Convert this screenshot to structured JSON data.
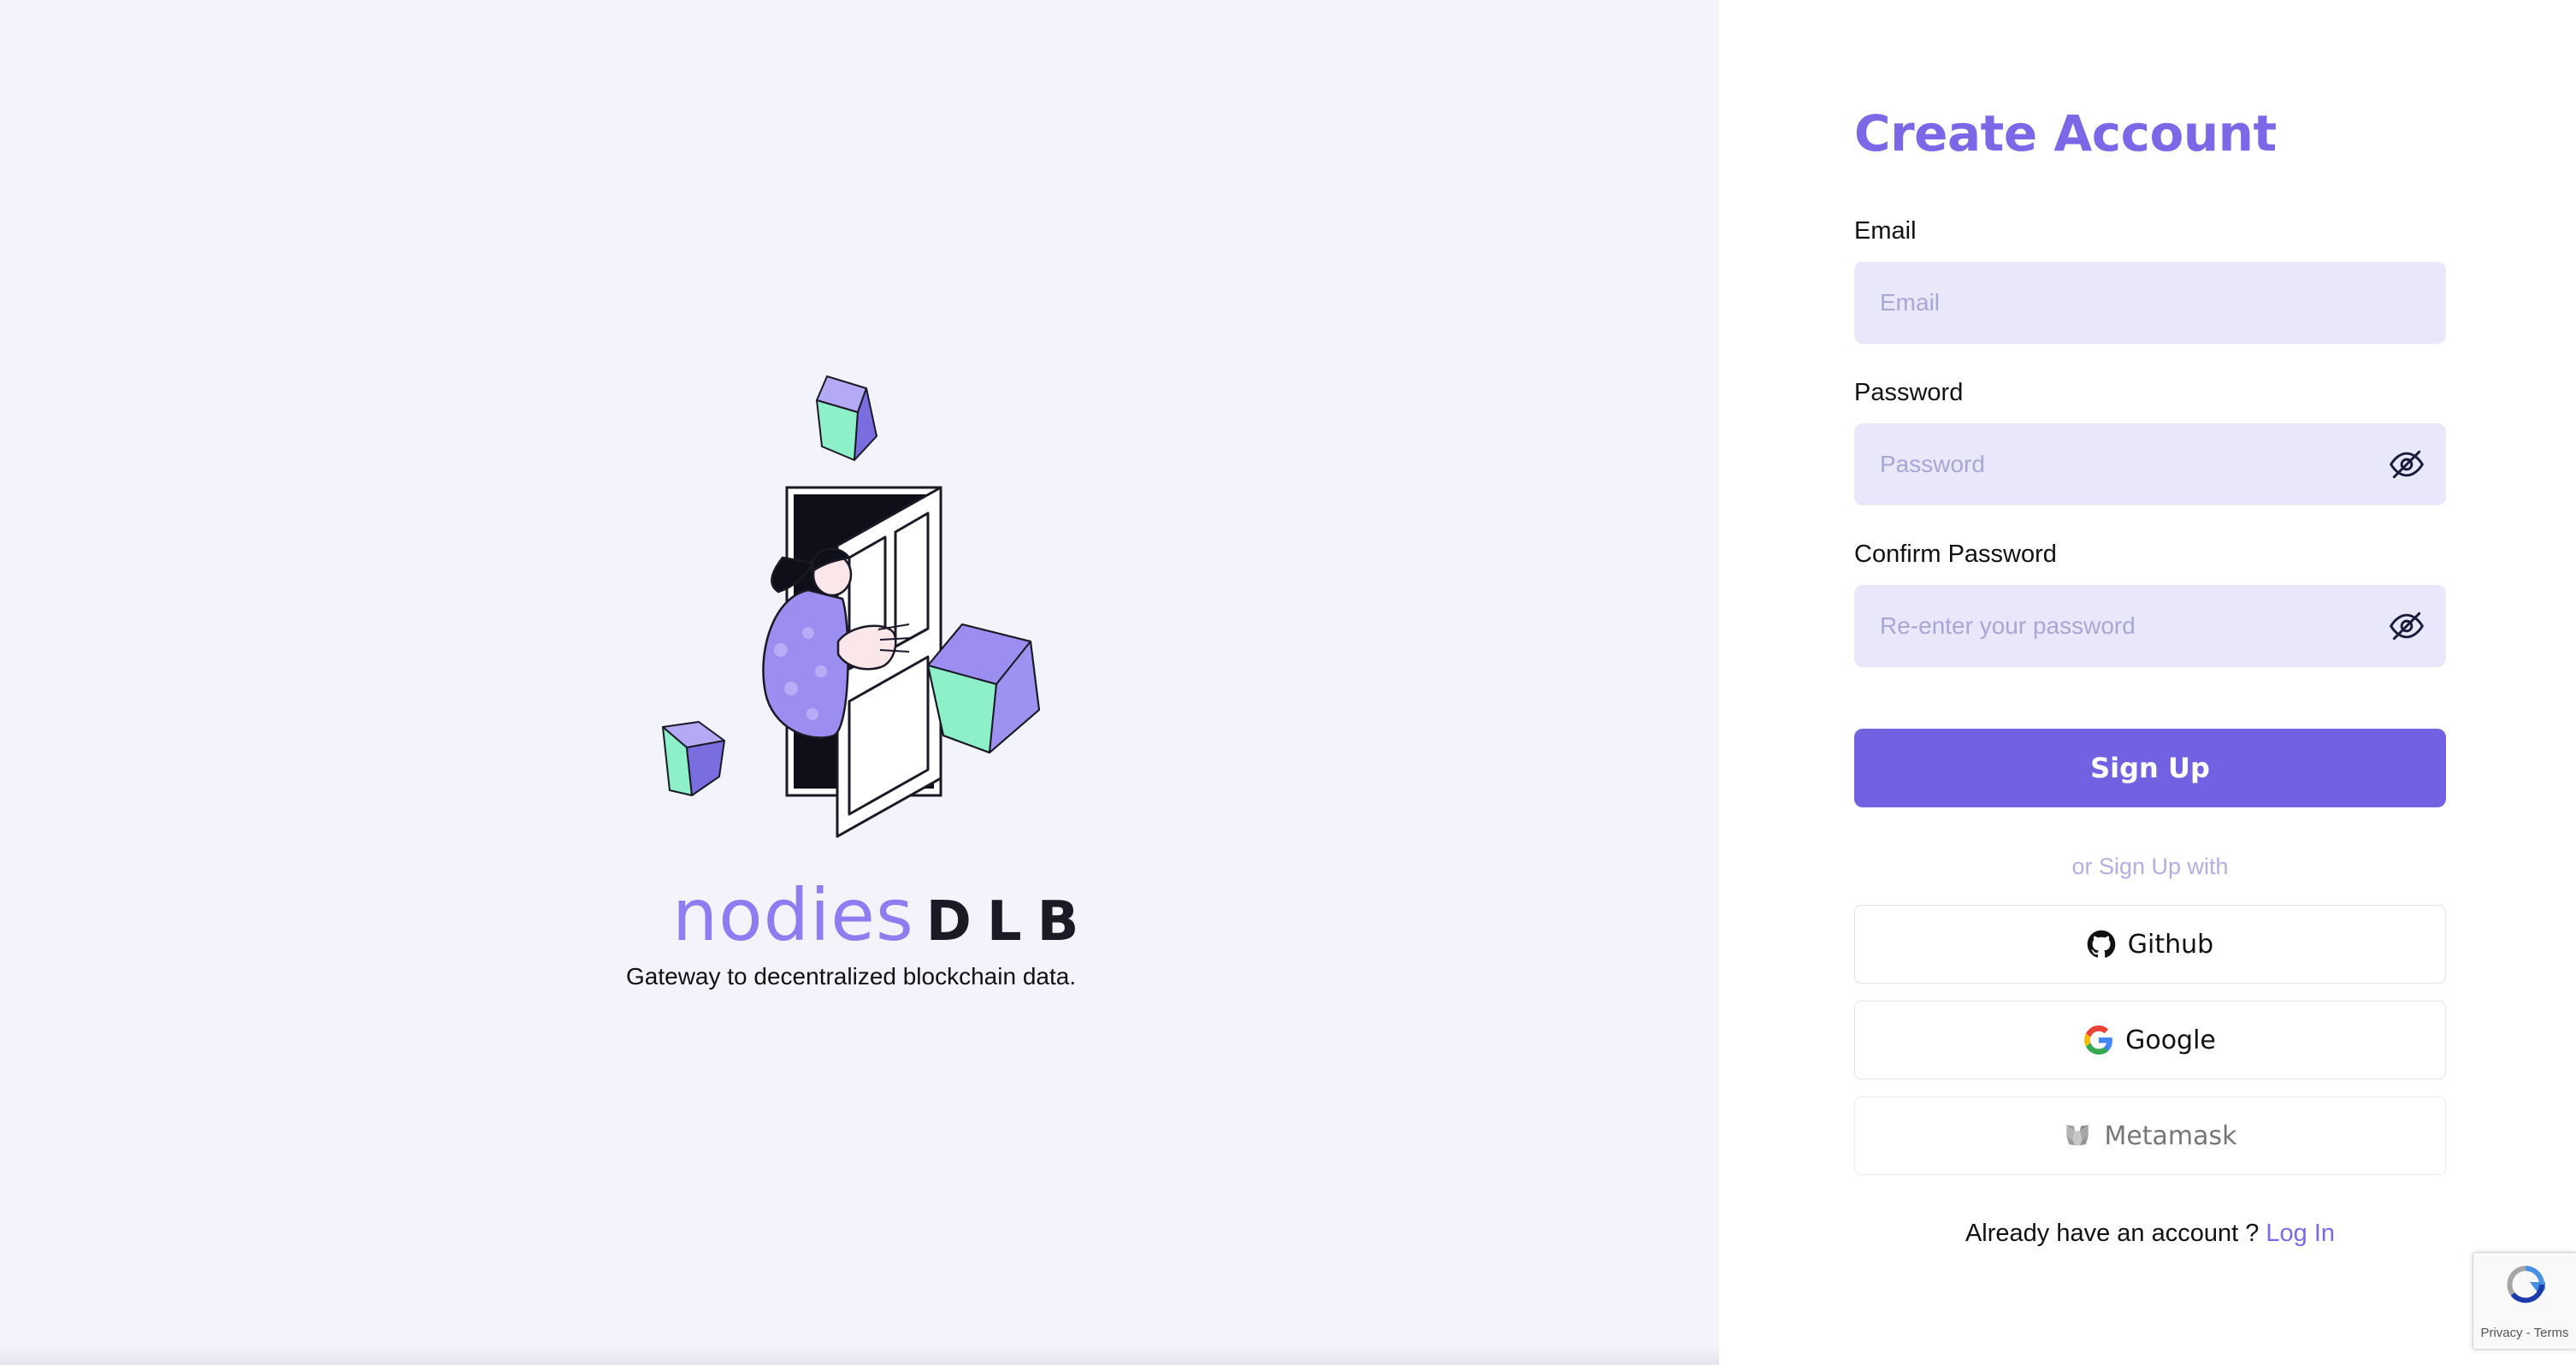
{
  "brand": {
    "name_part1": "nodies",
    "name_part2": "DLB",
    "tagline": "Gateway to decentralized blockchain data."
  },
  "form": {
    "title": "Create Account",
    "email": {
      "label": "Email",
      "placeholder": "Email",
      "value": ""
    },
    "password": {
      "label": "Password",
      "placeholder": "Password",
      "value": "",
      "toggle_icon": "eye-off-icon"
    },
    "confirm_password": {
      "label": "Confirm Password",
      "placeholder": "Re-enter your password",
      "value": "",
      "toggle_icon": "eye-off-icon"
    },
    "submit_label": "Sign Up",
    "divider_text": "or Sign Up with",
    "sso": [
      {
        "label": "Github",
        "icon": "github-icon",
        "enabled": true
      },
      {
        "label": "Google",
        "icon": "google-icon",
        "enabled": true
      },
      {
        "label": "Metamask",
        "icon": "metamask-icon",
        "enabled": false
      }
    ],
    "login_prompt": "Already have an account ?",
    "login_link": "Log In"
  },
  "recaptcha": {
    "text": "Privacy - Terms"
  },
  "colors": {
    "accent": "#7262e2",
    "title": "#7b68e6",
    "left_bg": "#f3f3fb",
    "input_bg": "#e9e8fa",
    "cube_purple": "#9b8ef0",
    "cube_green": "#8ef0c8"
  }
}
